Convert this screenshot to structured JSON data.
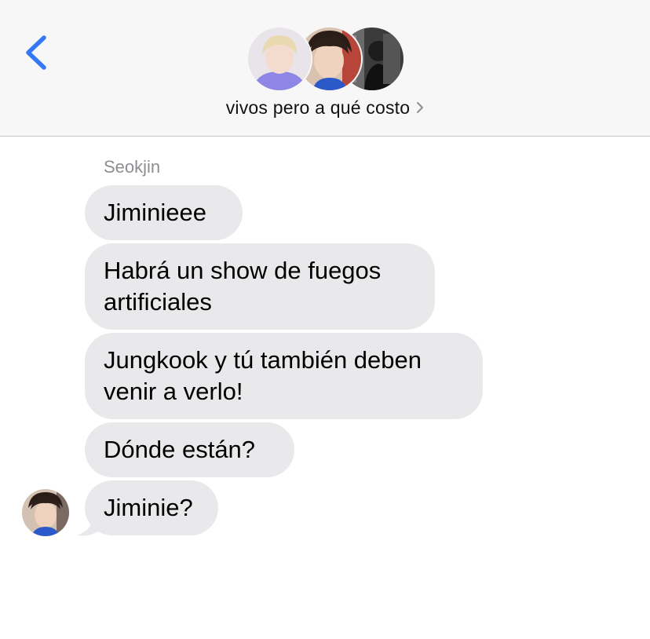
{
  "header": {
    "group_title": "vivos pero a qué costo",
    "back_icon": "chevron-left-icon",
    "back_color": "#3478f6",
    "avatars": [
      "participant-avatar-jimin",
      "participant-avatar-seokjin",
      "participant-avatar-third"
    ]
  },
  "conversation": {
    "sender_name": "Seokjin",
    "bubble_color": "#e9e9eb",
    "messages": [
      {
        "lines": [
          "Jiminieee"
        ]
      },
      {
        "lines": [
          "Habrá un show de fuegos",
          "artificiales"
        ]
      },
      {
        "lines": [
          "Jungkook y tú también deben",
          "venir a verlo!"
        ]
      },
      {
        "lines": [
          "Dónde están?"
        ]
      },
      {
        "lines": [
          "Jiminie?"
        ]
      }
    ]
  }
}
